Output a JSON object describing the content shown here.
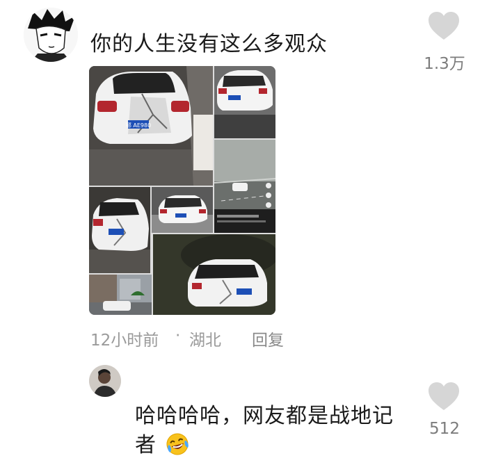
{
  "comment1": {
    "text": "你的人生没有这么多观众",
    "likes": "1.3万",
    "time": "12小时前",
    "separator": "·",
    "location": "湖北",
    "reply_label": "回复",
    "plate_text": "鄂 AE980"
  },
  "comment2": {
    "line1": "哈哈哈哈，网友都是战地记",
    "line2": "者",
    "emoji": "🤣",
    "likes": "512"
  },
  "colors": {
    "heart": "#d6d6d6",
    "meta": "#9a9a9a",
    "text": "#1a1a1a"
  }
}
